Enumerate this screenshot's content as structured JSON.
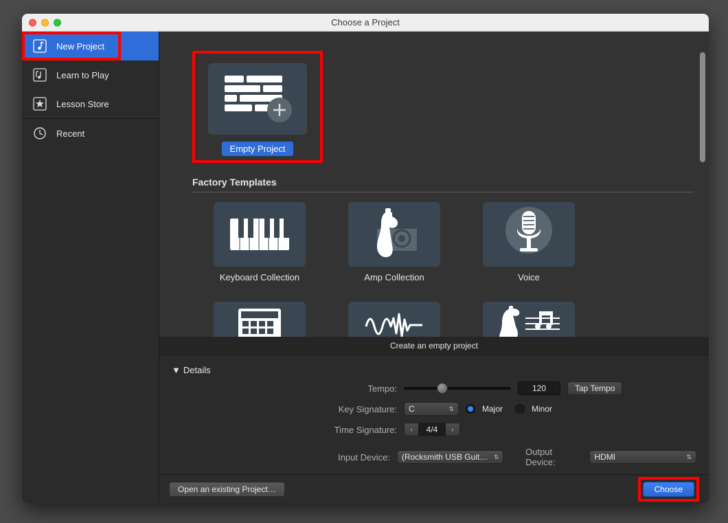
{
  "window": {
    "title": "Choose a Project"
  },
  "sidebar": {
    "items": [
      {
        "label": "New Project",
        "icon": "music-note-icon",
        "selected": true
      },
      {
        "label": "Learn to Play",
        "icon": "tutorial-icon",
        "selected": false
      },
      {
        "label": "Lesson Store",
        "icon": "star-icon",
        "selected": false
      },
      {
        "label": "Recent",
        "icon": "clock-icon",
        "selected": false
      }
    ]
  },
  "main": {
    "empty_project_label": "Empty Project",
    "factory_templates_label": "Factory Templates",
    "templates": [
      {
        "label": "Keyboard Collection"
      },
      {
        "label": "Amp Collection"
      },
      {
        "label": "Voice"
      }
    ],
    "description": "Create an empty project"
  },
  "details": {
    "toggle_label": "Details",
    "tempo_label": "Tempo:",
    "tempo_value": "120",
    "tap_tempo_label": "Tap Tempo",
    "key_signature_label": "Key Signature:",
    "key_value": "C",
    "major_label": "Major",
    "minor_label": "Minor",
    "scale_selected": "Major",
    "time_signature_label": "Time Signature:",
    "time_signature_value": "4/4",
    "input_device_label": "Input Device:",
    "input_device_value": "(Rocksmith USB Guit…",
    "output_device_label": "Output Device:",
    "output_device_value": "HDMI"
  },
  "footer": {
    "open_existing_label": "Open an existing Project…",
    "choose_label": "Choose"
  },
  "highlights": {
    "sidebar_new_project": true,
    "empty_project_tile": true,
    "choose_button": true
  },
  "colors": {
    "accent": "#2f6dd9",
    "highlight": "#ff0000"
  }
}
